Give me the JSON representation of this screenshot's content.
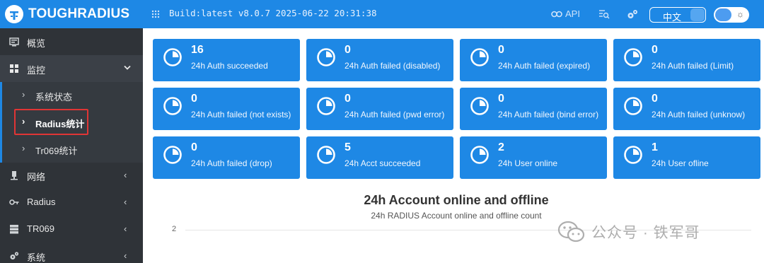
{
  "header": {
    "brand": "TOUGHRADIUS",
    "build": "Build:latest v8.0.7 2025-06-22 20:31:38",
    "api_label": "API",
    "lang_label": "中文",
    "theme_icon": "sun-icon",
    "accent_color": "#1e88e5"
  },
  "sidebar": {
    "items": [
      {
        "label": "概览",
        "icon": "dashboard-icon",
        "caret": ""
      },
      {
        "label": "监控",
        "icon": "grid-icon",
        "caret": "⌄"
      },
      {
        "label": "系统状态",
        "caret": "›"
      },
      {
        "label": "Radius统计",
        "caret": "›"
      },
      {
        "label": "Tr069统计",
        "caret": "›"
      },
      {
        "label": "网络",
        "icon": "network-icon",
        "caret": "‹"
      },
      {
        "label": "Radius",
        "icon": "key-icon",
        "caret": "‹"
      },
      {
        "label": "TR069",
        "icon": "server-icon",
        "caret": "‹"
      },
      {
        "label": "系统",
        "icon": "gears-icon",
        "caret": "‹"
      }
    ]
  },
  "cards": [
    {
      "value": "16",
      "label": "24h Auth succeeded"
    },
    {
      "value": "0",
      "label": "24h Auth failed (disabled)"
    },
    {
      "value": "0",
      "label": "24h Auth failed (expired)"
    },
    {
      "value": "0",
      "label": "24h Auth failed (Limit)"
    },
    {
      "value": "0",
      "label": "24h Auth failed (not exists)"
    },
    {
      "value": "0",
      "label": "24h Auth failed (pwd error)"
    },
    {
      "value": "0",
      "label": "24h Auth failed (bind error)"
    },
    {
      "value": "0",
      "label": "24h Auth failed (unknow)"
    },
    {
      "value": "0",
      "label": "24h Auth failed (drop)"
    },
    {
      "value": "5",
      "label": "24h Acct succeeded"
    },
    {
      "value": "2",
      "label": "24h User online"
    },
    {
      "value": "1",
      "label": "24h User ofline"
    }
  ],
  "chart": {
    "title": "24h Account online and offline",
    "subtitle": "24h RADIUS Account online and offline count",
    "y_tick_top": "2"
  },
  "watermark": {
    "text": "公众号 · 铁军哥"
  }
}
